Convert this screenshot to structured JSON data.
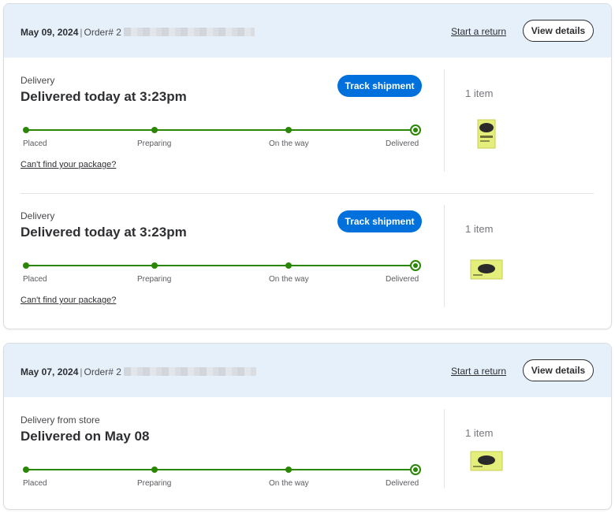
{
  "orders": [
    {
      "date": "May 09, 2024",
      "order_prefix": "Order# 2",
      "start_return": "Start a return",
      "view_details": "View details",
      "shipments": [
        {
          "type": "Delivery",
          "status": "Delivered today at 3:23pm",
          "track_label": "Track shipment",
          "steps": [
            "Placed",
            "Preparing",
            "On the way",
            "Delivered"
          ],
          "cant_find": "Can't find your package?",
          "item_count": "1 item"
        },
        {
          "type": "Delivery",
          "status": "Delivered today at 3:23pm",
          "track_label": "Track shipment",
          "steps": [
            "Placed",
            "Preparing",
            "On the way",
            "Delivered"
          ],
          "cant_find": "Can't find your package?",
          "item_count": "1 item"
        }
      ]
    },
    {
      "date": "May 07, 2024",
      "order_prefix": "Order# 2",
      "start_return": "Start a return",
      "view_details": "View details",
      "shipments": [
        {
          "type": "Delivery from store",
          "status": "Delivered on May 08",
          "steps": [
            "Placed",
            "Preparing",
            "On the way",
            "Delivered"
          ],
          "item_count": "1 item"
        }
      ]
    }
  ],
  "colors": {
    "header_bg": "#e6f0fb",
    "accent_blue": "#0071dc",
    "progress_green": "#2a8703",
    "product_yellow": "#e4ee7a"
  },
  "progress_fraction": 1.0
}
